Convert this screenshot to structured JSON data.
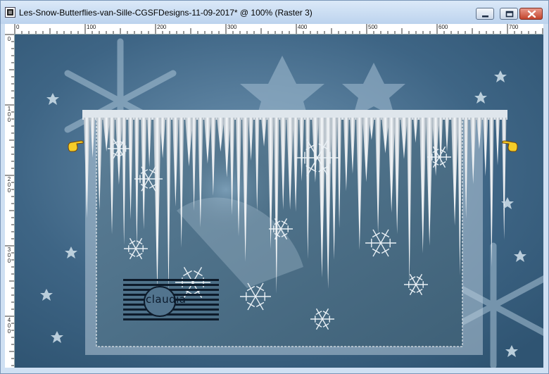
{
  "window": {
    "title": "Les-Snow-Butterflies-van-Sille-CGSFDesigns-11-09-2017* @ 100% (Raster 3)"
  },
  "controls": {
    "minimize": "minimize-icon",
    "maximize": "maximize-icon",
    "close": "close-icon"
  },
  "rulers": {
    "top_labels": [
      "0",
      "100",
      "200",
      "300",
      "400",
      "500",
      "600",
      "700"
    ],
    "left_labels": [
      "0",
      "1 0 0",
      "2 0 0",
      "3 0 0",
      "4 0 0"
    ]
  },
  "artwork": {
    "watermark_text": "claudia"
  },
  "colors": {
    "titlebar": "#cfe0f3",
    "frame_blue": "#3e6585",
    "inner_panel": "#44677f",
    "icicle": "#e8eef3"
  }
}
